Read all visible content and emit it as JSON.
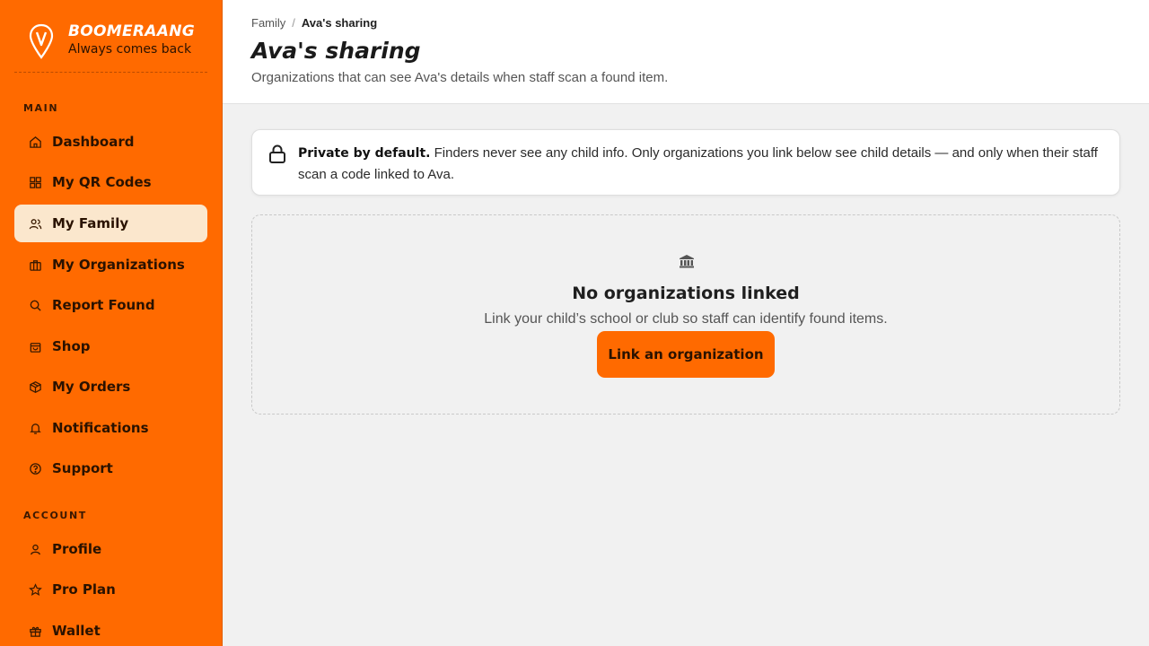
{
  "brand": {
    "name": "BOOMERAANG",
    "tagline": "Always comes back",
    "logo_icon": "boomerang-pin-logo"
  },
  "sidebar": {
    "main_label": "MAIN",
    "account_label": "ACCOUNT",
    "main_items": [
      {
        "label": "Dashboard",
        "icon": "home-icon"
      },
      {
        "label": "My QR Codes",
        "icon": "qr-grid-icon"
      },
      {
        "label": "My Family",
        "icon": "users-icon",
        "active": true
      },
      {
        "label": "My Organizations",
        "icon": "briefcase-icon"
      },
      {
        "label": "Report Found",
        "icon": "search-icon"
      },
      {
        "label": "Shop",
        "icon": "shopping-bag-icon"
      },
      {
        "label": "My Orders",
        "icon": "package-icon"
      },
      {
        "label": "Notifications",
        "icon": "bell-icon"
      },
      {
        "label": "Support",
        "icon": "help-circle-icon"
      }
    ],
    "account_items": [
      {
        "label": "Profile",
        "icon": "user-icon"
      },
      {
        "label": "Pro Plan",
        "icon": "star-icon"
      },
      {
        "label": "Wallet",
        "icon": "gift-icon"
      }
    ]
  },
  "header": {
    "breadcrumb": {
      "parent": "Family",
      "separator": "/",
      "current": "Ava's sharing"
    },
    "title": "Ava's sharing",
    "subtitle": "Organizations that can see Ava's details when staff scan a found item."
  },
  "privacy_notice": {
    "icon": "lock-icon",
    "bold": "Private by default.",
    "text": " Finders never see any child info. Only organizations you link below see child details — and only when their staff scan a code linked to Ava."
  },
  "empty_state": {
    "icon": "organization-icon",
    "title": "No organizations linked",
    "description": "Link your child’s school or club so staff can identify found items.",
    "button_label": "Link an organization"
  },
  "colors": {
    "brand_orange": "#ff6a00",
    "active_nav_bg": "#fbe7cd",
    "page_bg": "#f1f1f1"
  }
}
